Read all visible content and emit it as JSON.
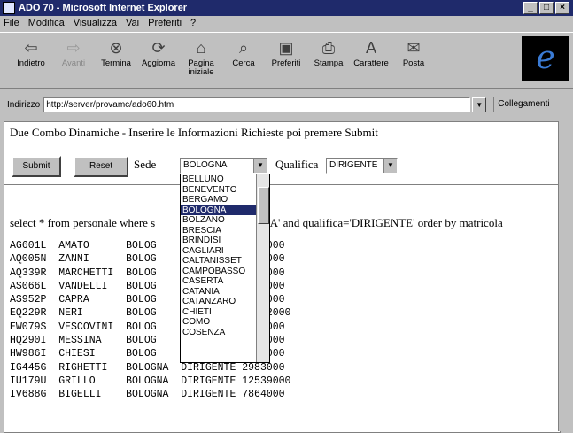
{
  "window": {
    "title": "ADO 70 - Microsoft Internet Explorer"
  },
  "menu": [
    "File",
    "Modifica",
    "Visualizza",
    "Vai",
    "Preferiti",
    "?"
  ],
  "toolbar": [
    {
      "label": "Indietro",
      "icon": "back-arrow-icon"
    },
    {
      "label": "Avanti",
      "icon": "forward-arrow-icon"
    },
    {
      "label": "Termina",
      "icon": "stop-icon"
    },
    {
      "label": "Aggiorna",
      "icon": "refresh-icon"
    },
    {
      "label": "Pagina iniziale",
      "icon": "home-icon"
    },
    {
      "label": "Cerca",
      "icon": "search-icon"
    },
    {
      "label": "Preferiti",
      "icon": "favorites-icon"
    },
    {
      "label": "Stampa",
      "icon": "print-icon"
    },
    {
      "label": "Carattere",
      "icon": "font-icon"
    },
    {
      "label": "Posta",
      "icon": "mail-icon"
    }
  ],
  "address": {
    "label": "Indirizzo",
    "url": "http://server/provamc/ado60.htm",
    "links_label": "Collegamenti"
  },
  "page": {
    "heading": "Due Combo Dinamiche - Inserire le Informazioni Richieste poi premere Submit",
    "submit_label": "Submit",
    "reset_label": "Reset",
    "sede_label": "Sede",
    "sede_value": "BOLOGNA",
    "qualifica_label": "Qualifica",
    "qualifica_value": "DIRIGENTE",
    "sql_left": "select * from personale where s",
    "sql_right": "NA' and qualifica='DIRIGENTE' order by matricola"
  },
  "dropdown_options": [
    "BELLUNO",
    "BENEVENTO",
    "BERGAMO",
    "BOLOGNA",
    "BOLZANO",
    "BRESCIA",
    "BRINDISI",
    "CAGLIARI",
    "CALTANISSET",
    "CAMPOBASSO",
    "CASERTA",
    "CATANIA",
    "CATANZARO",
    "CHIETI",
    "COMO",
    "COSENZA"
  ],
  "dropdown_selected": "BOLOGNA",
  "rows": [
    [
      "AG601L",
      "AMATO",
      "BOLOG",
      "",
      "7950000"
    ],
    [
      "AQ005N",
      "ZANNI",
      "BOLOG",
      "",
      "3571000"
    ],
    [
      "AQ339R",
      "MARCHETTI",
      "BOLOG",
      "",
      "3395000"
    ],
    [
      "AS066L",
      "VANDELLI",
      "BOLOG",
      "",
      "4536000"
    ],
    [
      "AS952P",
      "CAPRA",
      "BOLOG",
      "",
      "6005000"
    ],
    [
      "EQ229R",
      "NERI",
      "BOLOG",
      "",
      "13002000"
    ],
    [
      "EW079S",
      "VESCOVINI",
      "BOLOG",
      "",
      "6191000"
    ],
    [
      "HQ290I",
      "MESSINA",
      "BOLOG",
      "",
      "4673000"
    ],
    [
      "HW986I",
      "CHIESI",
      "BOLOG",
      "DIRIGENTE",
      "5662000"
    ],
    [
      "IG445G",
      "RIGHETTI",
      "BOLOGNA",
      "DIRIGENTE",
      "2983000"
    ],
    [
      "IU179U",
      "GRILLO",
      "BOLOGNA",
      "DIRIGENTE",
      "12539000"
    ],
    [
      "IV688G",
      "BIGELLI",
      "BOLOGNA",
      "DIRIGENTE",
      "7864000"
    ]
  ]
}
